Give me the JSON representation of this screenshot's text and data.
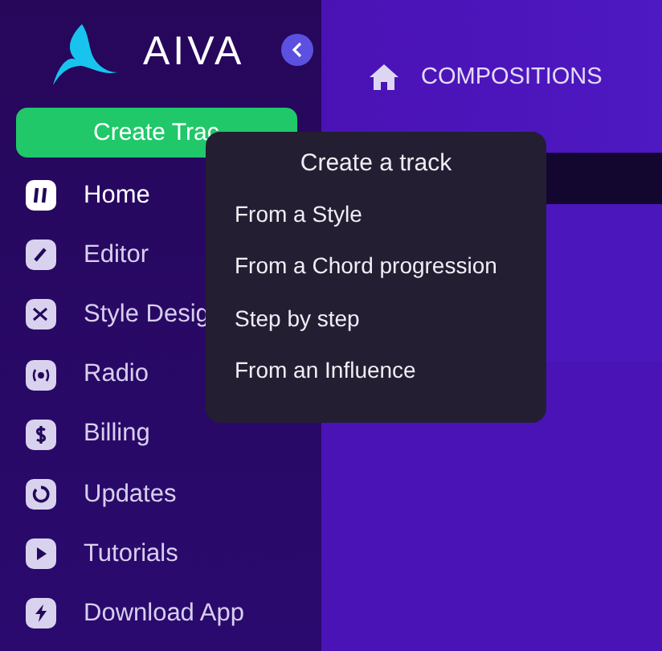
{
  "brand": {
    "name": "AIVA"
  },
  "create_button": {
    "label": "Create Trac"
  },
  "sidebar": {
    "items": [
      {
        "label": "Home",
        "selected": true
      },
      {
        "label": "Editor",
        "selected": false
      },
      {
        "label": "Style Desig",
        "selected": false
      },
      {
        "label": "Radio",
        "selected": false
      },
      {
        "label": "Billing",
        "selected": false
      },
      {
        "label": "Updates",
        "selected": false
      },
      {
        "label": "Tutorials",
        "selected": false
      },
      {
        "label": "Download App",
        "selected": false
      }
    ]
  },
  "header": {
    "title": "COMPOSITIONS"
  },
  "menu": {
    "title": "Create a track",
    "items": [
      "From a Style",
      "From a Chord progression",
      "Step by step",
      "From an Influence"
    ]
  }
}
